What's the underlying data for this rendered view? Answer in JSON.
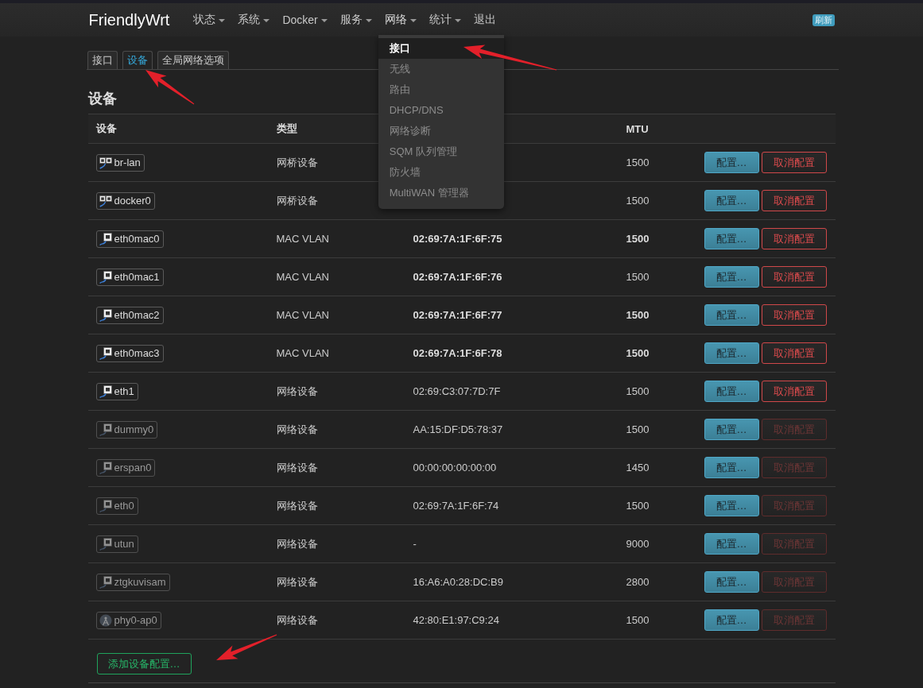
{
  "navbar": {
    "brand": "FriendlyWrt",
    "items": [
      {
        "label": "状态",
        "caret": true
      },
      {
        "label": "系统",
        "caret": true
      },
      {
        "label": "Docker",
        "caret": true
      },
      {
        "label": "服务",
        "caret": true
      },
      {
        "label": "网络",
        "caret": true,
        "menu": [
          {
            "label": "接口",
            "selected": true
          },
          {
            "label": "无线",
            "selected": false
          },
          {
            "label": "路由",
            "selected": false
          },
          {
            "label": "DHCP/DNS",
            "selected": false
          },
          {
            "label": "网络诊断",
            "selected": false
          },
          {
            "label": "SQM 队列管理",
            "selected": false
          },
          {
            "label": "防火墙",
            "selected": false
          },
          {
            "label": "MultiWAN 管理器",
            "selected": false
          }
        ]
      },
      {
        "label": "统计",
        "caret": true
      },
      {
        "label": "退出",
        "caret": false
      }
    ],
    "refresh_badge": "刷新"
  },
  "tabs": [
    {
      "label": "接口",
      "selected": false
    },
    {
      "label": "设备",
      "selected": true
    },
    {
      "label": "全局网络选项",
      "selected": false
    }
  ],
  "section": {
    "title": "设备",
    "columns": {
      "device": "设备",
      "type": "类型",
      "mtu": "MTU"
    },
    "rows": [
      {
        "device": {
          "name": "br-lan",
          "kind": "bridge",
          "active": true
        },
        "type": "网桥设备",
        "mtu": "1500",
        "mtu_bold": false,
        "configure": {
          "label": "配置…"
        },
        "unconfigure": {
          "label": "取消配置",
          "disabled": false
        }
      },
      {
        "device": {
          "name": "docker0",
          "kind": "bridge",
          "active": true
        },
        "type": "网桥设备",
        "mtu": "1500",
        "mtu_bold": false,
        "configure": {
          "label": "配置…"
        },
        "unconfigure": {
          "label": "取消配置",
          "disabled": false
        }
      },
      {
        "device": {
          "name": "eth0mac0",
          "kind": "ethernet",
          "active": true
        },
        "type": "MAC VLAN",
        "mac": "02:69:7A:1F:6F:75",
        "mac_bold": true,
        "mtu": "1500",
        "mtu_bold": true,
        "configure": {
          "label": "配置…"
        },
        "unconfigure": {
          "label": "取消配置",
          "disabled": false
        }
      },
      {
        "device": {
          "name": "eth0mac1",
          "kind": "ethernet",
          "active": true
        },
        "type": "MAC VLAN",
        "mac": "02:69:7A:1F:6F:76",
        "mac_bold": true,
        "mtu": "1500",
        "mtu_bold": false,
        "configure": {
          "label": "配置…"
        },
        "unconfigure": {
          "label": "取消配置",
          "disabled": false
        }
      },
      {
        "device": {
          "name": "eth0mac2",
          "kind": "ethernet",
          "active": true
        },
        "type": "MAC VLAN",
        "mac": "02:69:7A:1F:6F:77",
        "mac_bold": true,
        "mtu": "1500",
        "mtu_bold": true,
        "configure": {
          "label": "配置…"
        },
        "unconfigure": {
          "label": "取消配置",
          "disabled": false
        }
      },
      {
        "device": {
          "name": "eth0mac3",
          "kind": "ethernet",
          "active": true
        },
        "type": "MAC VLAN",
        "mac": "02:69:7A:1F:6F:78",
        "mac_bold": true,
        "mtu": "1500",
        "mtu_bold": true,
        "configure": {
          "label": "配置…"
        },
        "unconfigure": {
          "label": "取消配置",
          "disabled": false
        }
      },
      {
        "device": {
          "name": "eth1",
          "kind": "ethernet",
          "active": true
        },
        "type": "网络设备",
        "mac": "02:69:C3:07:7D:7F",
        "mac_bold": false,
        "mtu": "1500",
        "mtu_bold": false,
        "configure": {
          "label": "配置…"
        },
        "unconfigure": {
          "label": "取消配置",
          "disabled": false
        }
      },
      {
        "device": {
          "name": "dummy0",
          "kind": "ethernet",
          "active": false
        },
        "type": "网络设备",
        "mac": "AA:15:DF:D5:78:37",
        "mac_bold": false,
        "mtu": "1500",
        "mtu_bold": false,
        "configure": {
          "label": "配置…"
        },
        "unconfigure": {
          "label": "取消配置",
          "disabled": true
        }
      },
      {
        "device": {
          "name": "erspan0",
          "kind": "ethernet",
          "active": false
        },
        "type": "网络设备",
        "mac": "00:00:00:00:00:00",
        "mac_bold": false,
        "mtu": "1450",
        "mtu_bold": false,
        "configure": {
          "label": "配置…"
        },
        "unconfigure": {
          "label": "取消配置",
          "disabled": true
        }
      },
      {
        "device": {
          "name": "eth0",
          "kind": "ethernet",
          "active": false
        },
        "type": "网络设备",
        "mac": "02:69:7A:1F:6F:74",
        "mac_bold": false,
        "mtu": "1500",
        "mtu_bold": false,
        "configure": {
          "label": "配置…"
        },
        "unconfigure": {
          "label": "取消配置",
          "disabled": true
        }
      },
      {
        "device": {
          "name": "utun",
          "kind": "ethernet",
          "active": false
        },
        "type": "网络设备",
        "mac": "-",
        "mac_bold": false,
        "mtu": "9000",
        "mtu_bold": false,
        "configure": {
          "label": "配置…"
        },
        "unconfigure": {
          "label": "取消配置",
          "disabled": true
        }
      },
      {
        "device": {
          "name": "ztgkuvisam",
          "kind": "ethernet",
          "active": false
        },
        "type": "网络设备",
        "mac": "16:A6:A0:28:DC:B9",
        "mac_bold": false,
        "mtu": "2800",
        "mtu_bold": false,
        "configure": {
          "label": "配置…"
        },
        "unconfigure": {
          "label": "取消配置",
          "disabled": true
        }
      },
      {
        "device": {
          "name": "phy0-ap0",
          "kind": "wireless",
          "active": false
        },
        "type": "网络设备",
        "mac": "42:80:E1:97:C9:24",
        "mac_bold": false,
        "mtu": "1500",
        "mtu_bold": false,
        "configure": {
          "label": "配置…"
        },
        "unconfigure": {
          "label": "取消配置",
          "disabled": true
        }
      }
    ],
    "add_button": "添加设备配置…"
  }
}
